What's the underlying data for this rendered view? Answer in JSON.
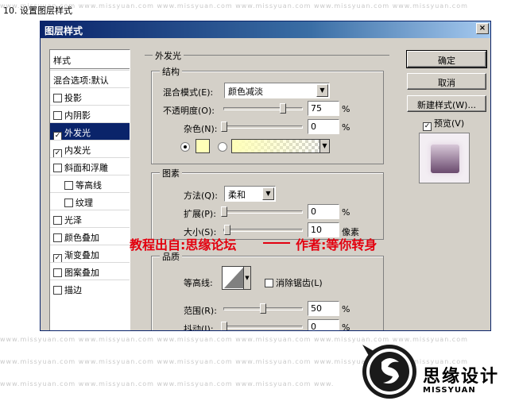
{
  "caption": "10. 设置图层样式",
  "watermark": "www.missyuan.com",
  "dialog": {
    "title": "图层样式",
    "close": "×",
    "style_list": {
      "header": "样式",
      "items": [
        {
          "label": "混合选项:默认",
          "checkbox": false,
          "checked": false,
          "selected": false,
          "indent": false
        },
        {
          "label": "投影",
          "checkbox": true,
          "checked": false,
          "selected": false,
          "indent": false
        },
        {
          "label": "内阴影",
          "checkbox": true,
          "checked": false,
          "selected": false,
          "indent": false
        },
        {
          "label": "外发光",
          "checkbox": true,
          "checked": true,
          "selected": true,
          "indent": false
        },
        {
          "label": "内发光",
          "checkbox": true,
          "checked": true,
          "selected": false,
          "indent": false
        },
        {
          "label": "斜面和浮雕",
          "checkbox": true,
          "checked": false,
          "selected": false,
          "indent": false
        },
        {
          "label": "等高线",
          "checkbox": true,
          "checked": false,
          "selected": false,
          "indent": true
        },
        {
          "label": "纹理",
          "checkbox": true,
          "checked": false,
          "selected": false,
          "indent": true
        },
        {
          "label": "光泽",
          "checkbox": true,
          "checked": false,
          "selected": false,
          "indent": false
        },
        {
          "label": "颜色叠加",
          "checkbox": true,
          "checked": false,
          "selected": false,
          "indent": false
        },
        {
          "label": "渐变叠加",
          "checkbox": true,
          "checked": true,
          "selected": false,
          "indent": false
        },
        {
          "label": "图案叠加",
          "checkbox": true,
          "checked": false,
          "selected": false,
          "indent": false
        },
        {
          "label": "描边",
          "checkbox": true,
          "checked": false,
          "selected": false,
          "indent": false
        }
      ]
    },
    "outer_glow": {
      "title": "外发光",
      "structure": {
        "title": "结构",
        "blend_mode_label": "混合模式(E):",
        "blend_mode_value": "颜色减淡",
        "opacity_label": "不透明度(O):",
        "opacity_value": "75",
        "opacity_unit": "%",
        "opacity_fraction": 0.75,
        "noise_label": "杂色(N):",
        "noise_value": "0",
        "noise_unit": "%",
        "noise_fraction": 0.0,
        "glow_color": "#ffffb8"
      },
      "elements": {
        "title": "图素",
        "technique_label": "方法(Q):",
        "technique_value": "柔和",
        "spread_label": "扩展(P):",
        "spread_value": "0",
        "spread_unit": "%",
        "spread_fraction": 0.0,
        "size_label": "大小(S):",
        "size_value": "10",
        "size_unit": "像素",
        "size_fraction": 0.04
      },
      "quality": {
        "title": "品质",
        "contour_label": "等高线:",
        "antialias_label": "消除锯齿(L)",
        "range_label": "范围(R):",
        "range_value": "50",
        "range_unit": "%",
        "range_fraction": 0.5,
        "jitter_label": "抖动(J):",
        "jitter_value": "0",
        "jitter_unit": "%",
        "jitter_fraction": 0.0
      }
    },
    "buttons": {
      "ok": "确定",
      "cancel": "取消",
      "new_style": "新建样式(W)...",
      "preview": "预览(V)"
    }
  },
  "overlay": {
    "source": "教程出自:思缘论坛",
    "author": "作者:等你转身"
  },
  "logo": {
    "text": "思缘设计",
    "subtext": "MISSYUAN"
  }
}
